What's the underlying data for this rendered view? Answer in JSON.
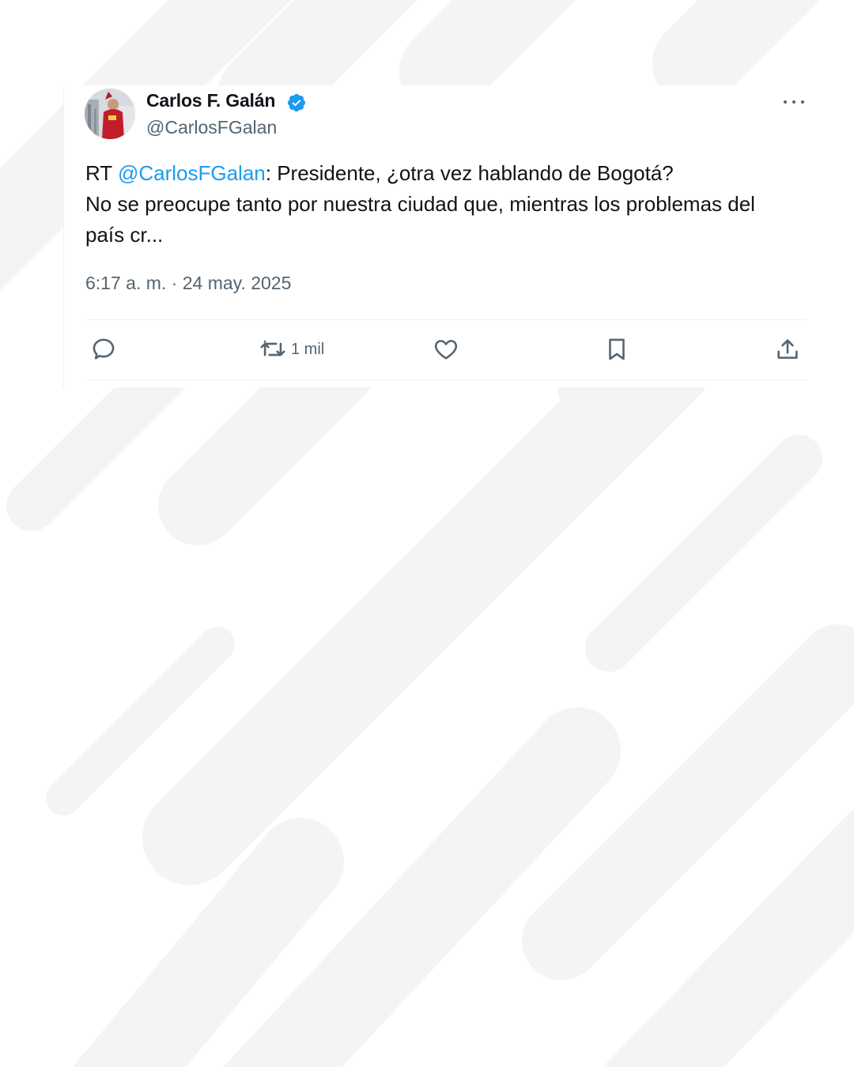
{
  "tweet": {
    "author_name": "Carlos F. Galán",
    "handle": "@CarlosFGalan",
    "text_prefix": "RT ",
    "mention": "@CarlosFGalan",
    "text_rest": ": Presidente, ¿otra vez hablando de Bogotá?",
    "text_line2": "No se preocupe tanto por nuestra ciudad que, mientras los problemas del país cr...",
    "timestamp": "6:17 a. m. · 24 may. 2025"
  },
  "actions": {
    "reply_icon": "reply-icon",
    "retweet_icon": "retweet-icon",
    "retweet_count": "1 mil",
    "like_icon": "heart-icon",
    "bookmark_icon": "bookmark-icon",
    "share_icon": "share-icon"
  },
  "colors": {
    "link": "#1d9bf0",
    "text": "#0f1419",
    "secondary": "#536471",
    "verified": "#1d9bf0",
    "background_stripes": "#f5f5f5"
  }
}
